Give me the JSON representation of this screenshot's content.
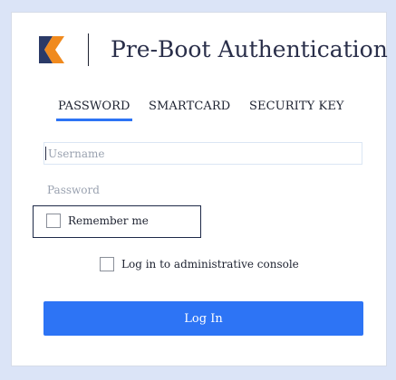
{
  "header": {
    "title": "Pre-Boot Authentication",
    "logo_icon": "brand-logo-icon"
  },
  "tabs": [
    {
      "label": "PASSWORD",
      "active": true
    },
    {
      "label": "SMARTCARD",
      "active": false
    },
    {
      "label": "SECURITY KEY",
      "active": false
    }
  ],
  "form": {
    "username": {
      "placeholder": "Username",
      "value": ""
    },
    "password": {
      "placeholder": "Password",
      "value": ""
    },
    "remember_me": {
      "label": "Remember me",
      "checked": false
    },
    "admin_console": {
      "label": "Log in to administrative console",
      "checked": false
    },
    "submit_label": "Log In"
  },
  "colors": {
    "accent": "#2d74f5",
    "logo_orange": "#f08a1e",
    "logo_navy": "#2b3a67",
    "background": "#dbe4f7"
  }
}
